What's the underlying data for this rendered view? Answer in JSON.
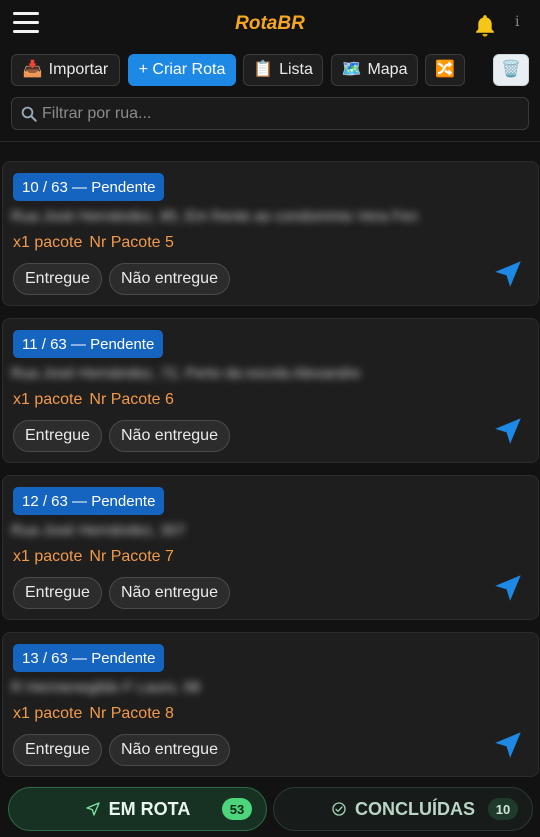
{
  "header": {
    "title": "RotaBR",
    "info": "i"
  },
  "toolbar": {
    "import_label": "Importar",
    "create_route_label": "+ Criar Rota",
    "list_label": "Lista",
    "map_label": "Mapa"
  },
  "filter": {
    "placeholder": "Filtrar por rua..."
  },
  "cards": [
    {
      "badge": "10 / 63 — Pendente",
      "address": "Rua José Hernández, 85, Em frente ao condomínio Vera Fen",
      "qty": "x1 pacote",
      "package": "Nr Pacote 5",
      "delivered_label": "Entregue",
      "not_delivered_label": "Não entregue"
    },
    {
      "badge": "11 / 63 — Pendente",
      "address": "Rua José Hernández, 72, Perto da escola Alexandre",
      "qty": "x1 pacote",
      "package": "Nr Pacote 6",
      "delivered_label": "Entregue",
      "not_delivered_label": "Não entregue"
    },
    {
      "badge": "12 / 63 — Pendente",
      "address": "Rua José Hernández, 307",
      "qty": "x1 pacote",
      "package": "Nr Pacote 7",
      "delivered_label": "Entregue",
      "not_delivered_label": "Não entregue"
    },
    {
      "badge": "13 / 63 — Pendente",
      "address": "R Hermenegildo F Lauro, 98",
      "qty": "x1 pacote",
      "package": "Nr Pacote 8",
      "delivered_label": "Entregue",
      "not_delivered_label": "Não entregue"
    }
  ],
  "bottom_tabs": {
    "active": {
      "label": "EM ROTA",
      "count": "53"
    },
    "done": {
      "label": "CONCLUÍDAS",
      "count": "10"
    }
  },
  "colors": {
    "accent": "#f5a623",
    "primary": "#1e88e5",
    "badge": "#1565c0",
    "package_text": "#f2994a",
    "active_tab": "#4cd57a"
  }
}
